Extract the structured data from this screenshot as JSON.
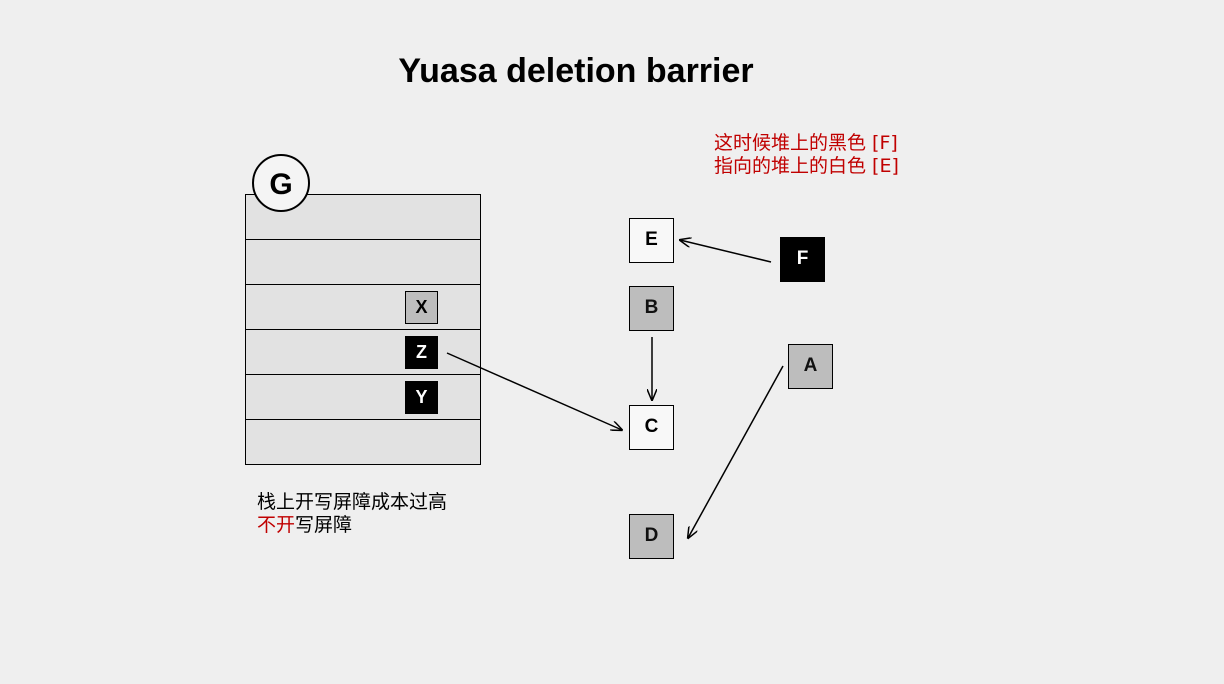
{
  "title": "Yuasa deletion barrier",
  "stack": {
    "root_label": "G",
    "rows": 6,
    "slots": [
      {
        "label": "X",
        "color": "grey"
      },
      {
        "label": "Z",
        "color": "black"
      },
      {
        "label": "Y",
        "color": "black"
      }
    ]
  },
  "nodes": {
    "E": {
      "label": "E",
      "color": "white"
    },
    "B": {
      "label": "B",
      "color": "grey"
    },
    "C": {
      "label": "C",
      "color": "white"
    },
    "D": {
      "label": "D",
      "color": "grey"
    },
    "F": {
      "label": "F",
      "color": "black"
    },
    "A": {
      "label": "A",
      "color": "grey"
    }
  },
  "edges": [
    {
      "from": "F",
      "to": "E"
    },
    {
      "from": "B",
      "to": "C"
    },
    {
      "from": "Z",
      "to": "C"
    },
    {
      "from": "A",
      "to": "D"
    }
  ],
  "annotation_heap": {
    "line1": "这时候堆上的黑色 [F]",
    "line2": "指向的堆上的白色 [E]"
  },
  "annotation_stack": {
    "line1": "栈上开写屏障成本过高",
    "line2_red": "不开",
    "line2_black": "写屏障"
  },
  "colors": {
    "background": "#efefef",
    "stack_fill": "#e2e2e2",
    "white_node": "#f8f8f8",
    "grey_node": "#bdbdbd",
    "black_node": "#000000",
    "annotation_red": "#c00000"
  }
}
